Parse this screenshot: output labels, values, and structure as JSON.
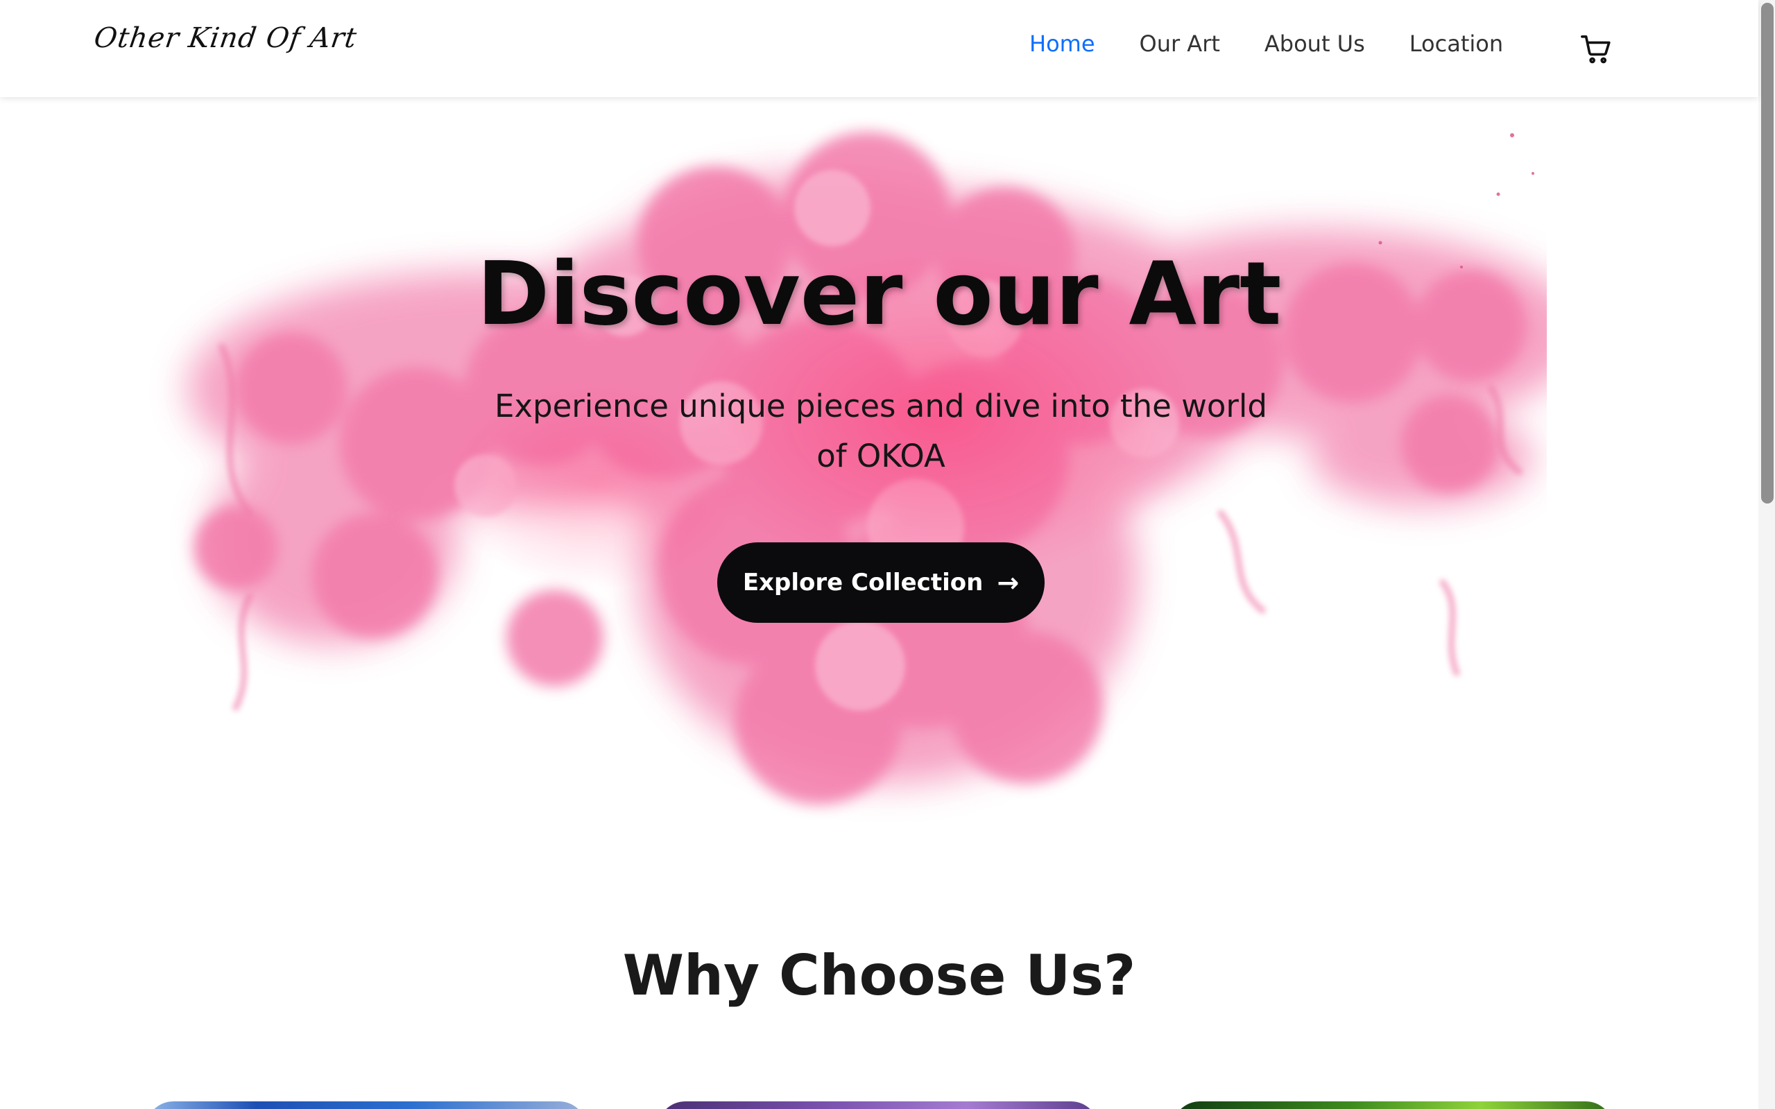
{
  "nav": {
    "logo": "Other Kind Of Art",
    "links": [
      "Home",
      "Our Art",
      "About Us",
      "Location"
    ],
    "active": "Home",
    "cart_icon": "cart-icon"
  },
  "hero": {
    "title": "Discover our Art",
    "subtitle": "Experience unique pieces and dive into the world of OKOA",
    "button_label": "Explore Collection",
    "button_icon": "arrow-right-icon"
  },
  "why": {
    "title": "Why Choose Us?"
  },
  "colors": {
    "accent": "#0d6efd",
    "button_bg": "#0b0b0d",
    "ink_pink": "#f06ba0"
  }
}
